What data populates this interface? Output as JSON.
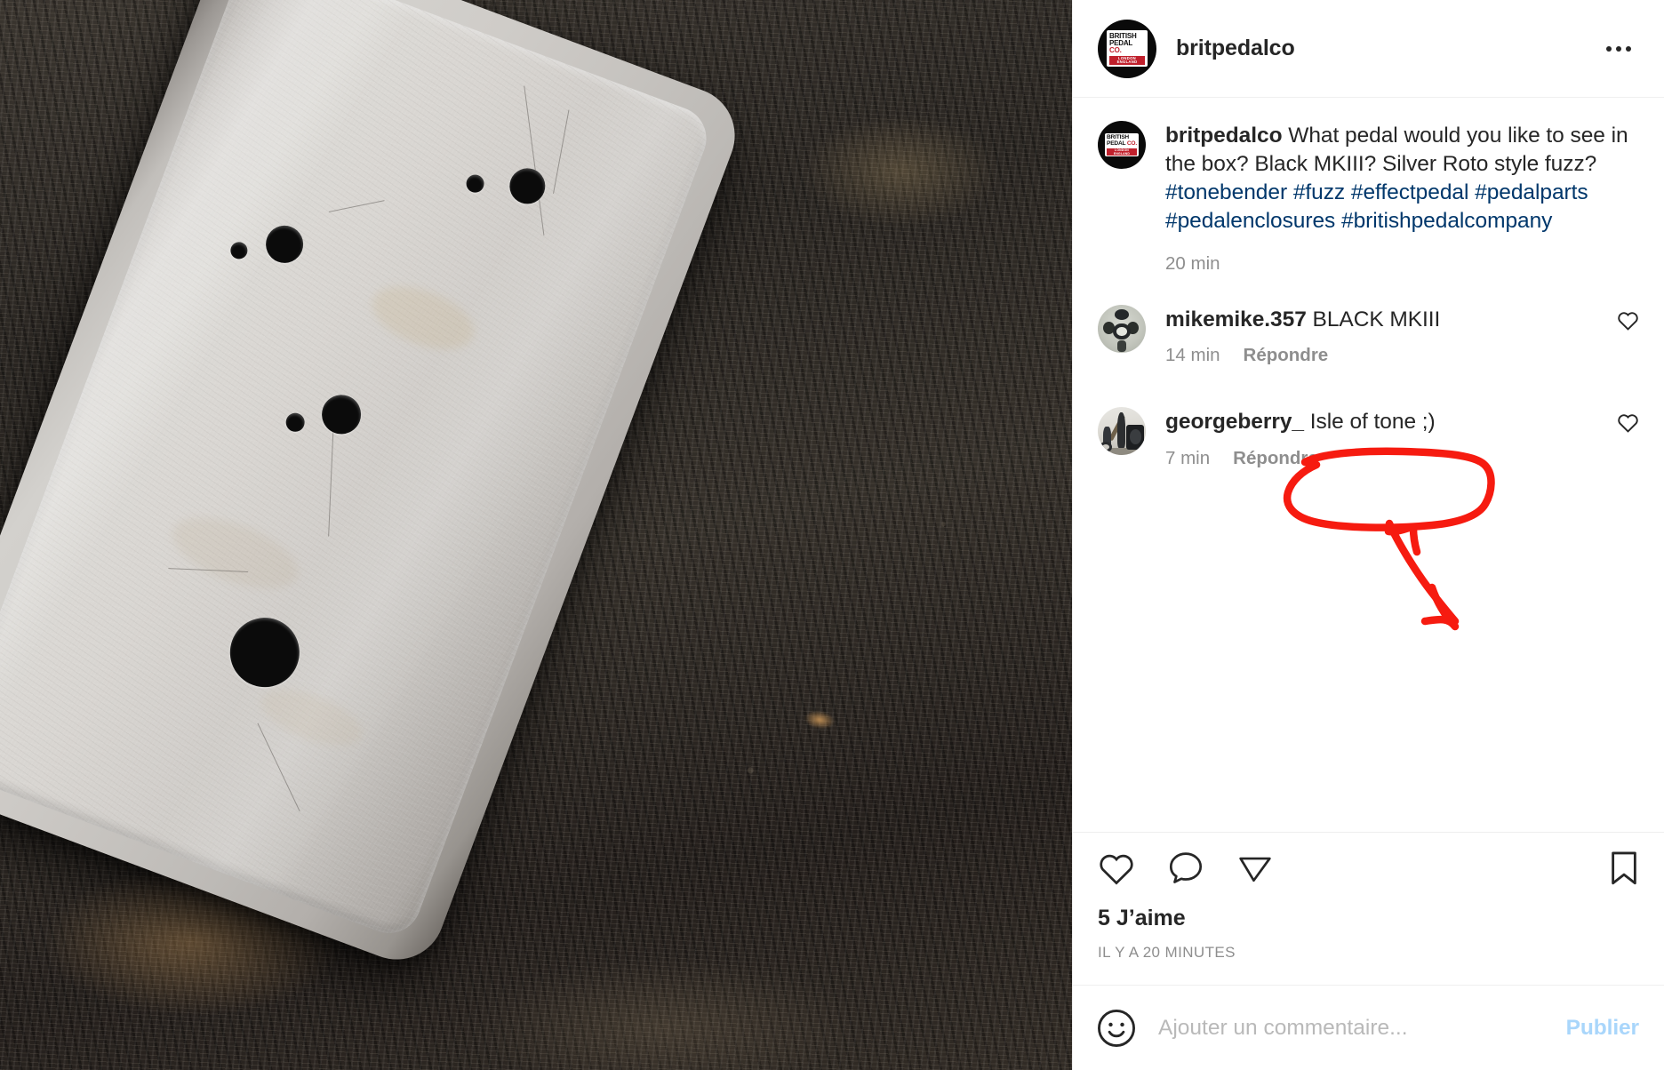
{
  "post": {
    "header": {
      "username": "britpedalco",
      "avatar_logo": {
        "line1": "BRITISH",
        "line2_brand": "PEDAL ",
        "line2_co": "CO.",
        "line3": "LONDON  ENGLAND"
      },
      "more_options_icon": "ellipsis-horizontal-icon"
    },
    "caption": {
      "username": "britpedalco",
      "text": "What pedal would you like to see in the box? Black MKIII? Silver Roto style fuzz? ",
      "hashtags": [
        "#tonebender",
        "#fuzz",
        "#effectpedal",
        "#pedalparts",
        "#pedalenclosures",
        "#britishpedalcompany"
      ],
      "timestamp": "20 min"
    },
    "comments": [
      {
        "username": "mikemike.357",
        "text": "BLACK MKIII",
        "timestamp": "14 min",
        "reply_label": "Répondre",
        "avatar_type": "drum-kit-photo",
        "like_icon": "heart-outline-icon"
      },
      {
        "username": "georgeberry_",
        "text": "Isle of tone ;)",
        "timestamp": "7 min",
        "reply_label": "Répondre",
        "avatar_type": "band-photo",
        "like_icon": "heart-outline-icon"
      }
    ],
    "actions": {
      "like_icon": "heart-outline-icon",
      "comment_icon": "speech-bubble-icon",
      "share_icon": "paper-plane-icon",
      "save_icon": "bookmark-outline-icon",
      "likes_count": "5 J’aime",
      "posted_ago": "IL Y A 20 MINUTES"
    },
    "add_comment": {
      "emoji_icon": "smiley-face-icon",
      "placeholder": "Ajouter un commentaire...",
      "value": "",
      "publish_label": "Publier"
    },
    "media": {
      "description": "Unfinished silver aluminium guitar pedal enclosure with drilled holes on a dark scratched workbench"
    },
    "annotation": {
      "color": "#f61b10",
      "shape": "hand-drawn-circle-with-arrow",
      "target_text": "Isle of tone ;)"
    }
  }
}
